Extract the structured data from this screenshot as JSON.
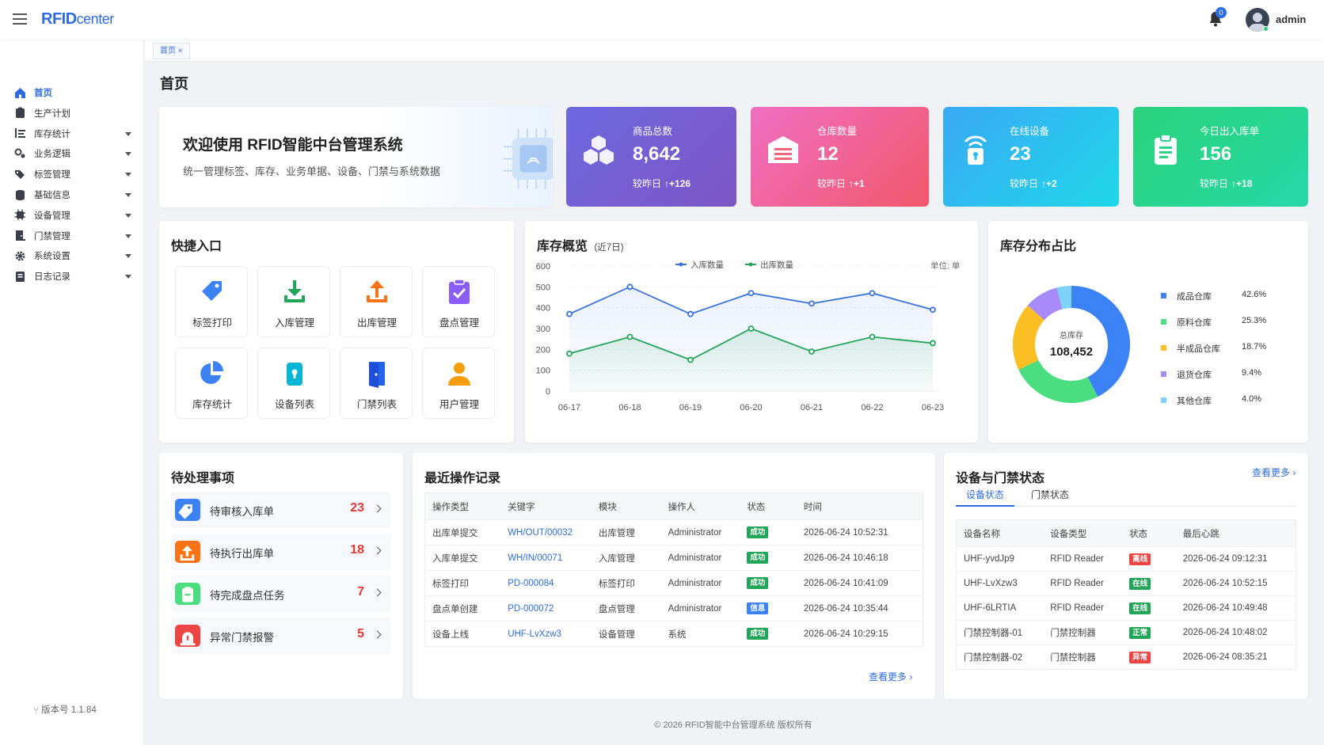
{
  "header": {
    "brand_main": "RFID",
    "brand_sub": "center",
    "notification_count": "0",
    "user": "admin"
  },
  "sidebar": {
    "items": [
      {
        "label": "首页",
        "icon": "home-icon",
        "active": true,
        "expandable": false
      },
      {
        "label": "生产计划",
        "icon": "clipboard-icon",
        "active": false,
        "expandable": false
      },
      {
        "label": "库存统计",
        "icon": "list-icon",
        "active": false,
        "expandable": true
      },
      {
        "label": "业务逻辑",
        "icon": "cogs-icon",
        "active": false,
        "expandable": true
      },
      {
        "label": "标签管理",
        "icon": "tags-icon",
        "active": false,
        "expandable": true
      },
      {
        "label": "基础信息",
        "icon": "database-icon",
        "active": false,
        "expandable": true
      },
      {
        "label": "设备管理",
        "icon": "chip-icon",
        "active": false,
        "expandable": true
      },
      {
        "label": "门禁管理",
        "icon": "door-icon",
        "active": false,
        "expandable": true
      },
      {
        "label": "系统设置",
        "icon": "gear-icon",
        "active": false,
        "expandable": true
      },
      {
        "label": "日志记录",
        "icon": "book-icon",
        "active": false,
        "expandable": true
      }
    ],
    "version": "版本号 1.1.84"
  },
  "tabs": {
    "home": "首页 ×"
  },
  "page": {
    "title": "首页"
  },
  "welcome": {
    "title": "欢迎使用 RFID智能中台管理系统",
    "subtitle": "统一管理标签、库存、业务单据、设备、门禁与系统数据"
  },
  "stats": [
    {
      "label": "商品总数",
      "value": "8,642",
      "compare_label": "较昨日",
      "delta": "↑+126",
      "icon": "cubes-icon"
    },
    {
      "label": "仓库数量",
      "value": "12",
      "compare_label": "较昨日",
      "delta": "↑+1",
      "icon": "warehouse-icon"
    },
    {
      "label": "在线设备",
      "value": "23",
      "compare_label": "较昨日",
      "delta": "↑+2",
      "icon": "wifi-device-icon"
    },
    {
      "label": "今日出入库单",
      "value": "156",
      "compare_label": "较昨日",
      "delta": "↑+18",
      "icon": "clipboard-list-icon"
    }
  ],
  "quick": {
    "title": "快捷入口",
    "items": [
      {
        "label": "标签打印",
        "icon": "tag-icon",
        "color": "#3b82f6"
      },
      {
        "label": "入库管理",
        "icon": "download-icon",
        "color": "#22a559"
      },
      {
        "label": "出库管理",
        "icon": "upload-icon",
        "color": "#f97316"
      },
      {
        "label": "盘点管理",
        "icon": "clipboard-check-icon",
        "color": "#8b5cf6"
      },
      {
        "label": "库存统计",
        "icon": "pie-icon",
        "color": "#3b82f6"
      },
      {
        "label": "设备列表",
        "icon": "device-icon",
        "color": "#06b6d4"
      },
      {
        "label": "门禁列表",
        "icon": "door-open-icon",
        "color": "#2563eb"
      },
      {
        "label": "用户管理",
        "icon": "user-icon",
        "color": "#f59e0b"
      }
    ]
  },
  "inventory_chart": {
    "title": "库存概览",
    "title_note": "(近7日)",
    "unit": "单位: 单"
  },
  "chart_data": [
    {
      "type": "line",
      "title": "库存概览 (近7日)",
      "x": [
        "06-17",
        "06-18",
        "06-19",
        "06-20",
        "06-21",
        "06-22",
        "06-23"
      ],
      "series": [
        {
          "name": "入库数量",
          "color": "#3b74e0",
          "values": [
            370,
            500,
            370,
            470,
            420,
            470,
            390
          ]
        },
        {
          "name": "出库数量",
          "color": "#22a559",
          "values": [
            180,
            260,
            150,
            300,
            190,
            260,
            230
          ]
        }
      ],
      "ylim": [
        0,
        600
      ],
      "yticks": [
        0,
        100,
        200,
        300,
        400,
        500,
        600
      ],
      "unit": "单位: 单",
      "grid": true,
      "legend": "top"
    },
    {
      "type": "pie",
      "title": "库存分布占比",
      "center_label": "总库存",
      "center_value": "108,452",
      "labels": [
        "成品仓库",
        "原料仓库",
        "半成品仓库",
        "退货仓库",
        "其他仓库"
      ],
      "values": [
        42.6,
        25.3,
        18.7,
        9.4,
        4.0
      ],
      "value_labels": [
        "42.6%",
        "25.3%",
        "18.7%",
        "9.4%",
        "4.0%"
      ],
      "colors": [
        "#3b82f6",
        "#4ade80",
        "#fbbf24",
        "#a78bfa",
        "#7dd3fc"
      ],
      "legend": "right"
    }
  ],
  "pie": {
    "title": "库存分布占比"
  },
  "pending": {
    "title": "待处理事项",
    "items": [
      {
        "label": "待审核入库单",
        "count": "23",
        "icon": "tag-icon",
        "color": "#3b82f6"
      },
      {
        "label": "待执行出库单",
        "count": "18",
        "icon": "upload-icon",
        "color": "#f97316"
      },
      {
        "label": "待完成盘点任务",
        "count": "7",
        "icon": "clipboard-icon",
        "color": "#4ade80"
      },
      {
        "label": "异常门禁报警",
        "count": "5",
        "icon": "alarm-icon",
        "color": "#ef4444"
      }
    ]
  },
  "records": {
    "title": "最近操作记录",
    "headers": [
      "操作类型",
      "关键字",
      "模块",
      "操作人",
      "状态",
      "时间"
    ],
    "rows": [
      {
        "type": "出库单提交",
        "key": "WH/OUT/00032",
        "module": "出库管理",
        "operator": "Administrator",
        "status": "成功",
        "status_color": "#22a559",
        "time": "2026-06-24 10:52:31"
      },
      {
        "type": "入库单提交",
        "key": "WH/IN/00071",
        "module": "入库管理",
        "operator": "Administrator",
        "status": "成功",
        "status_color": "#22a559",
        "time": "2026-06-24 10:46:18"
      },
      {
        "type": "标签打印",
        "key": "PD-000084",
        "module": "标签打印",
        "operator": "Administrator",
        "status": "成功",
        "status_color": "#22a559",
        "time": "2026-06-24 10:41:09"
      },
      {
        "type": "盘点单创建",
        "key": "PD-000072",
        "module": "盘点管理",
        "operator": "Administrator",
        "status": "信息",
        "status_color": "#3b82f6",
        "time": "2026-06-24 10:35:44"
      },
      {
        "type": "设备上线",
        "key": "UHF-LvXzw3",
        "module": "设备管理",
        "operator": "系统",
        "status": "成功",
        "status_color": "#22a559",
        "time": "2026-06-24 10:29:15"
      }
    ],
    "more": "查看更多 ›"
  },
  "devices": {
    "title": "设备与门禁状态",
    "more": "查看更多 ›",
    "tabs": [
      "设备状态",
      "门禁状态"
    ],
    "headers": [
      "设备名称",
      "设备类型",
      "状态",
      "最后心跳"
    ],
    "rows": [
      {
        "name": "UHF-yvdJp9",
        "type": "RFID Reader",
        "status": "离线",
        "status_color": "#ef4444",
        "time": "2026-06-24 09:12:31"
      },
      {
        "name": "UHF-LvXzw3",
        "type": "RFID Reader",
        "status": "在线",
        "status_color": "#22a559",
        "time": "2026-06-24 10:52:15"
      },
      {
        "name": "UHF-6LRTIA",
        "type": "RFID Reader",
        "status": "在线",
        "status_color": "#22a559",
        "time": "2026-06-24 10:49:48"
      },
      {
        "name": "门禁控制器-01",
        "type": "门禁控制器",
        "status": "正常",
        "status_color": "#22a559",
        "time": "2026-06-24 10:48:02"
      },
      {
        "name": "门禁控制器-02",
        "type": "门禁控制器",
        "status": "异常",
        "status_color": "#ef4444",
        "time": "2026-06-24 08:35:21"
      }
    ]
  },
  "footer": "© 2026 RFID智能中台管理系统 版权所有"
}
